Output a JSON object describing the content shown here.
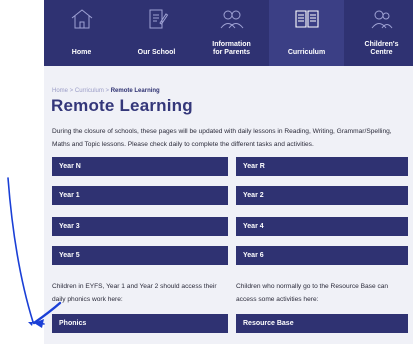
{
  "nav": {
    "items": [
      {
        "label": "Home",
        "icon": "home-icon"
      },
      {
        "label": "Our School",
        "icon": "document-pen-icon"
      },
      {
        "label": "Information\nfor Parents",
        "icon": "parents-icon"
      },
      {
        "label": "Curriculum",
        "icon": "open-book-icon"
      },
      {
        "label": "Children's\nCentre",
        "icon": "children-icon"
      }
    ],
    "active": "Curriculum"
  },
  "breadcrumb": {
    "home": "Home",
    "sep1": " > ",
    "curriculum": "Curriculum",
    "sep2": " > ",
    "current": "Remote Learning"
  },
  "title": "Remote Learning",
  "intro": "During the closure of schools, these pages will be updated with daily lessons in Reading, Writing, Grammar/Spelling, Maths and Topic lessons.  Please check daily to complete the different tasks and activities.",
  "years": {
    "yn": "Year N",
    "yr": "Year R",
    "y1": "Year 1",
    "y2": "Year 2",
    "y3": "Year 3",
    "y4": "Year 4",
    "y5": "Year 5",
    "y6": "Year 6"
  },
  "notes": {
    "left": "Children in EYFS, Year 1 and Year 2 should access their daily phonics work here:",
    "right": "Children who normally go to the Resource Base can access some activities here:"
  },
  "links": {
    "phonics": "Phonics",
    "resource": "Resource Base"
  },
  "colors": {
    "nav": "#2f3272",
    "button": "#2f3272",
    "background": "#f0f1f7",
    "annotation": "#1a3fd6"
  }
}
